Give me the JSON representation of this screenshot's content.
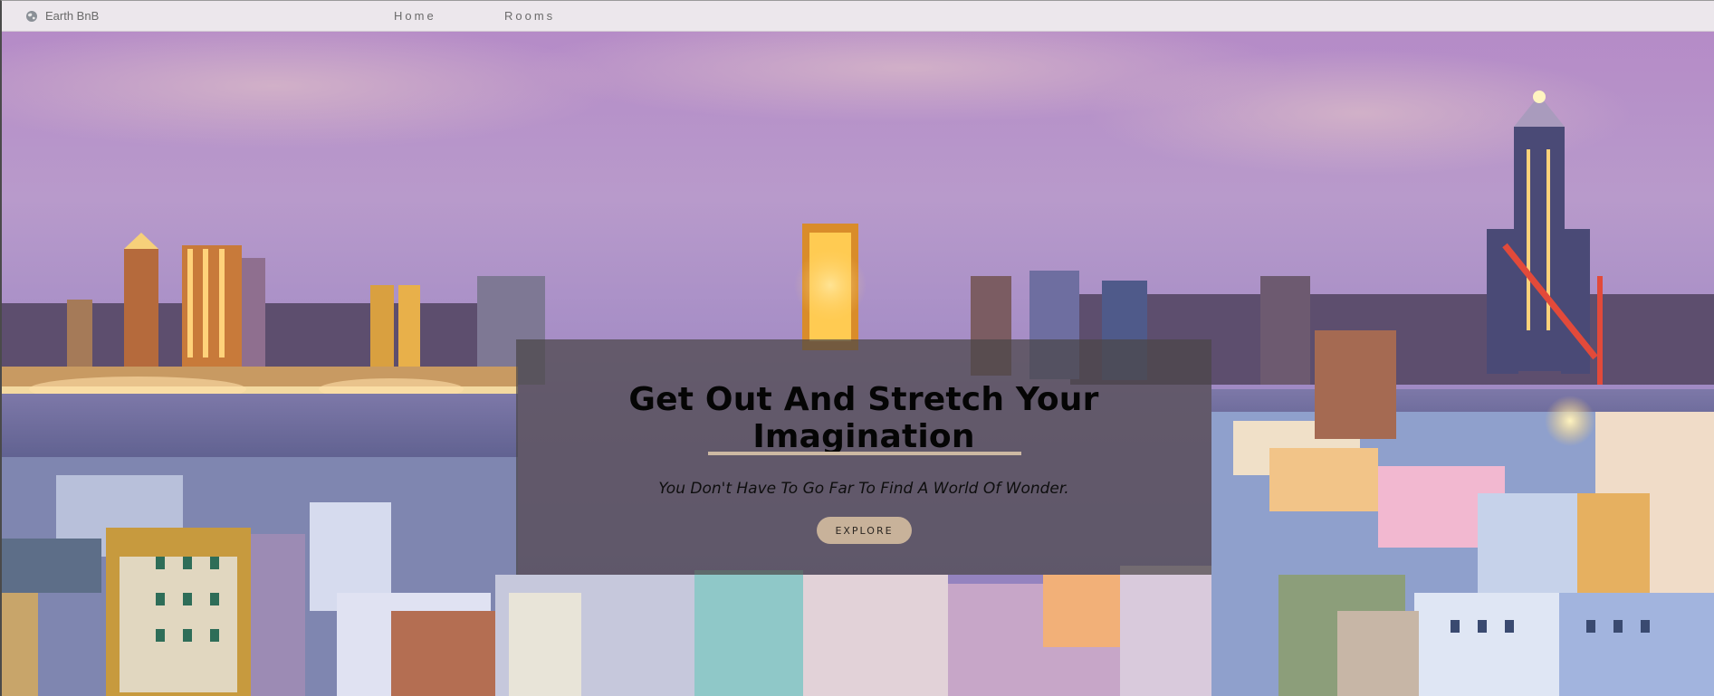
{
  "navbar": {
    "brand_icon": "globe-icon",
    "brand_label": "Earth BnB",
    "links": [
      {
        "label": "Home"
      },
      {
        "label": "Rooms"
      }
    ]
  },
  "hero": {
    "title": "Get Out And Stretch Your Imagination",
    "subtitle": "You Don't Have To Go Far To Find A World Of Wonder.",
    "cta_label": "EXPLORE"
  },
  "colors": {
    "navbar_bg": "#ece7ec",
    "nav_text": "#6b6b6b",
    "card_overlay": "rgba(75,70,72,0.72)",
    "divider": "#cdb9a3",
    "cta_bg": "#c8b29a"
  }
}
